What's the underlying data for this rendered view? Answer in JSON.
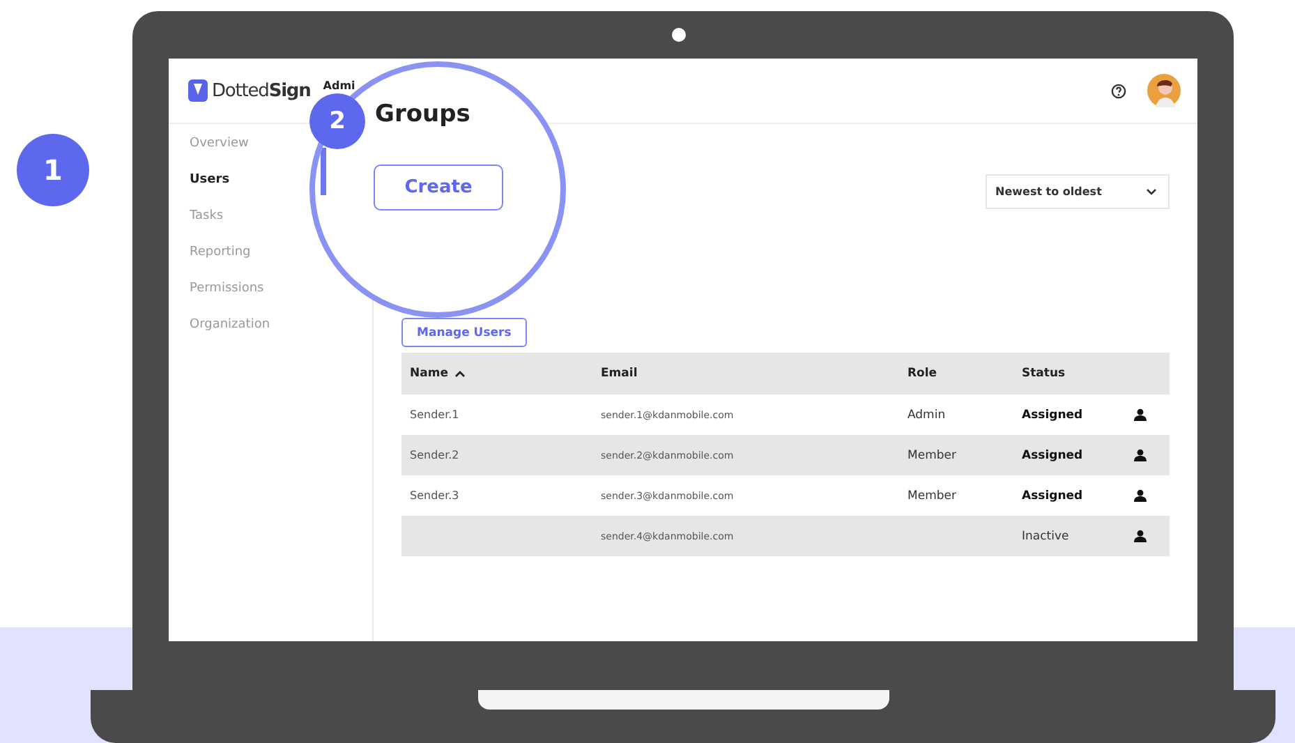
{
  "steps": [
    {
      "label": "1"
    },
    {
      "label": "2"
    }
  ],
  "header": {
    "logo": "Dotted**Sign**",
    "section": "Admi"
  },
  "sidebar": {
    "items": [
      {
        "label": "Overview",
        "selected": false
      },
      {
        "label": "Users",
        "selected": true
      },
      {
        "label": "Tasks",
        "selected": false
      },
      {
        "label": "Reporting",
        "selected": false
      },
      {
        "label": "Permissions",
        "selected": false
      },
      {
        "label": "Organization",
        "selected": false
      }
    ]
  },
  "page": {
    "title": "Groups",
    "create_button": "Create",
    "sort": "Newest to oldest",
    "manage_button": "Manage Users"
  },
  "table": {
    "columns": [
      {
        "label": "Name",
        "sorted": true
      },
      {
        "label": "Email",
        "sorted": false
      },
      {
        "label": "Role",
        "sorted": false
      },
      {
        "label": "Status",
        "sorted": false
      }
    ],
    "rows": [
      {
        "name": "Sender.1",
        "email": "sender.1@kdanmobile.com",
        "role": "Admin",
        "status": "Assigned",
        "active": true
      },
      {
        "name": "Sender.2",
        "email": "sender.2@kdanmobile.com",
        "role": "Member",
        "status": "Assigned",
        "active": true
      },
      {
        "name": "Sender.3",
        "email": "sender.3@kdanmobile.com",
        "role": "Member",
        "status": "Assigned",
        "active": true
      },
      {
        "email": "sender.4@kdanmobile.com",
        "status": "Inactive",
        "active": false
      }
    ]
  }
}
